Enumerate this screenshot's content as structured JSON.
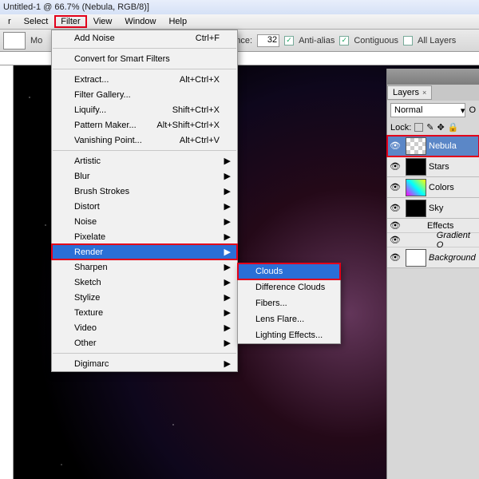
{
  "title": "Untitled-1 @ 66.7% (Nebula, RGB/8)]",
  "menubar": {
    "items": [
      "r",
      "Select",
      "Filter",
      "View",
      "Window",
      "Help"
    ],
    "filterIndex": 2
  },
  "options": {
    "mode_label": "Mo",
    "nce_label": "nce:",
    "nce_value": "32",
    "antialias": "Anti-alias",
    "contiguous": "Contiguous",
    "alllayers": "All Layers"
  },
  "filter_menu": {
    "addnoise": {
      "label": "Add Noise",
      "shortcut": "Ctrl+F"
    },
    "smart": "Convert for Smart Filters",
    "items_a": [
      {
        "label": "Extract...",
        "shortcut": "Alt+Ctrl+X"
      },
      {
        "label": "Filter Gallery...",
        "shortcut": ""
      },
      {
        "label": "Liquify...",
        "shortcut": "Shift+Ctrl+X"
      },
      {
        "label": "Pattern Maker...",
        "shortcut": "Alt+Shift+Ctrl+X"
      },
      {
        "label": "Vanishing Point...",
        "shortcut": "Alt+Ctrl+V"
      }
    ],
    "subcats": [
      "Artistic",
      "Blur",
      "Brush Strokes",
      "Distort",
      "Noise",
      "Pixelate",
      "Render",
      "Sharpen",
      "Sketch",
      "Stylize",
      "Texture",
      "Video",
      "Other"
    ],
    "renderIndex": 6,
    "digimarc": "Digimarc"
  },
  "render_submenu": [
    "Clouds",
    "Difference Clouds",
    "Fibers...",
    "Lens Flare...",
    "Lighting Effects..."
  ],
  "render_highlight_index": 0,
  "layers_panel": {
    "tab": "Layers",
    "blend": "Normal",
    "opacity_label": "O",
    "lock": "Lock:",
    "layers": [
      {
        "name": "Nebula",
        "thumb": "th-check",
        "sel": true
      },
      {
        "name": "Stars",
        "thumb": "th-stars"
      },
      {
        "name": "Colors",
        "thumb": "th-col"
      },
      {
        "name": "Sky",
        "thumb": "th-stars",
        "fx": true
      },
      {
        "name": "Background",
        "thumb": "th-wh",
        "italic": true
      }
    ],
    "fx_label": "Effects",
    "fx_item": "Gradient O"
  }
}
